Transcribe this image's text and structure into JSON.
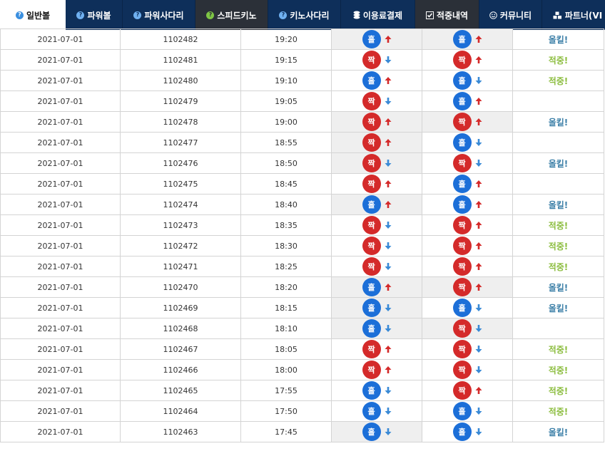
{
  "nav": [
    {
      "label": "일반볼",
      "icon": "help-icon",
      "style": "active",
      "w": 92
    },
    {
      "label": "파워볼",
      "icon": "help-icon",
      "style": "normal",
      "w": 80
    },
    {
      "label": "파워사다리",
      "icon": "help-icon",
      "style": "normal",
      "w": 102
    },
    {
      "label": "스피드키노",
      "icon": "help-icon",
      "style": "dark",
      "w": 102
    },
    {
      "label": "키노사다리",
      "icon": "help-icon",
      "style": "normal",
      "w": 102
    },
    {
      "label": "이용료결제",
      "icon": "coins-icon",
      "style": "normal",
      "w": 104
    },
    {
      "label": "적중내역",
      "icon": "checkbox-icon",
      "style": "dark",
      "w": 90
    },
    {
      "label": "커뮤니티",
      "icon": "smile-icon",
      "style": "normal",
      "w": 88
    },
    {
      "label": "파트너(VI",
      "icon": "cubes-icon",
      "style": "normal",
      "w": 100
    }
  ],
  "colors": {
    "hit": "#8cbd3f",
    "miss": "#3d80a8",
    "blue": "#1c6fd8",
    "red": "#d42a2a",
    "up": "#d42a2a",
    "down": "#3a8ad6"
  },
  "ball_labels": {
    "odd": "홀",
    "even": "짝"
  },
  "result_labels": {
    "hit": "적중!",
    "miss": "올킬!"
  },
  "rows": [
    {
      "date": "2021-07-01",
      "round": "1102482",
      "time": "19:20",
      "a": "odd",
      "a_dir": "up",
      "b": "odd",
      "b_dir": "up",
      "result": "miss"
    },
    {
      "date": "2021-07-01",
      "round": "1102481",
      "time": "19:15",
      "a": "even",
      "a_dir": "down",
      "b": "even",
      "b_dir": "up",
      "result": "hit"
    },
    {
      "date": "2021-07-01",
      "round": "1102480",
      "time": "19:10",
      "a": "odd",
      "a_dir": "up",
      "b": "odd",
      "b_dir": "down",
      "result": "hit"
    },
    {
      "date": "2021-07-01",
      "round": "1102479",
      "time": "19:05",
      "a": "even",
      "a_dir": "down",
      "b": "odd",
      "b_dir": "up",
      "result": ""
    },
    {
      "date": "2021-07-01",
      "round": "1102478",
      "time": "19:00",
      "a": "even",
      "a_dir": "up",
      "b": "even",
      "b_dir": "up",
      "result": "miss"
    },
    {
      "date": "2021-07-01",
      "round": "1102477",
      "time": "18:55",
      "a": "even",
      "a_dir": "up",
      "b": "odd",
      "b_dir": "down",
      "result": ""
    },
    {
      "date": "2021-07-01",
      "round": "1102476",
      "time": "18:50",
      "a": "even",
      "a_dir": "down",
      "b": "even",
      "b_dir": "down",
      "result": "miss"
    },
    {
      "date": "2021-07-01",
      "round": "1102475",
      "time": "18:45",
      "a": "even",
      "a_dir": "up",
      "b": "odd",
      "b_dir": "up",
      "result": ""
    },
    {
      "date": "2021-07-01",
      "round": "1102474",
      "time": "18:40",
      "a": "odd",
      "a_dir": "up",
      "b": "odd",
      "b_dir": "up",
      "result": "miss"
    },
    {
      "date": "2021-07-01",
      "round": "1102473",
      "time": "18:35",
      "a": "even",
      "a_dir": "down",
      "b": "even",
      "b_dir": "up",
      "result": "hit"
    },
    {
      "date": "2021-07-01",
      "round": "1102472",
      "time": "18:30",
      "a": "even",
      "a_dir": "down",
      "b": "even",
      "b_dir": "up",
      "result": "hit"
    },
    {
      "date": "2021-07-01",
      "round": "1102471",
      "time": "18:25",
      "a": "even",
      "a_dir": "down",
      "b": "even",
      "b_dir": "up",
      "result": "hit"
    },
    {
      "date": "2021-07-01",
      "round": "1102470",
      "time": "18:20",
      "a": "odd",
      "a_dir": "up",
      "b": "even",
      "b_dir": "up",
      "result": "miss"
    },
    {
      "date": "2021-07-01",
      "round": "1102469",
      "time": "18:15",
      "a": "odd",
      "a_dir": "down",
      "b": "odd",
      "b_dir": "down",
      "result": "miss"
    },
    {
      "date": "2021-07-01",
      "round": "1102468",
      "time": "18:10",
      "a": "odd",
      "a_dir": "down",
      "b": "even",
      "b_dir": "down",
      "result": ""
    },
    {
      "date": "2021-07-01",
      "round": "1102467",
      "time": "18:05",
      "a": "even",
      "a_dir": "up",
      "b": "even",
      "b_dir": "down",
      "result": "hit"
    },
    {
      "date": "2021-07-01",
      "round": "1102466",
      "time": "18:00",
      "a": "even",
      "a_dir": "up",
      "b": "even",
      "b_dir": "down",
      "result": "hit"
    },
    {
      "date": "2021-07-01",
      "round": "1102465",
      "time": "17:55",
      "a": "odd",
      "a_dir": "down",
      "b": "even",
      "b_dir": "up",
      "result": "hit"
    },
    {
      "date": "2021-07-01",
      "round": "1102464",
      "time": "17:50",
      "a": "odd",
      "a_dir": "down",
      "b": "odd",
      "b_dir": "down",
      "result": "hit"
    },
    {
      "date": "2021-07-01",
      "round": "1102463",
      "time": "17:45",
      "a": "odd",
      "a_dir": "down",
      "b": "odd",
      "b_dir": "down",
      "result": "miss"
    }
  ]
}
